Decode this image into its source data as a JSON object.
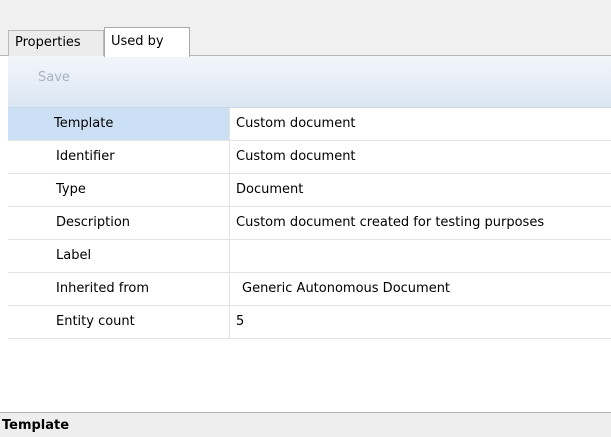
{
  "tabs": {
    "properties": "Properties",
    "used_by": "Used by"
  },
  "toolbar": {
    "save_label": "Save"
  },
  "grid": {
    "rows": [
      {
        "name": "Template",
        "value": "Custom document"
      },
      {
        "name": "Identifier",
        "value": "Custom document"
      },
      {
        "name": "Type",
        "value": "Document"
      },
      {
        "name": "Description",
        "value": "Custom document created for testing purposes"
      },
      {
        "name": "Label",
        "value": ""
      },
      {
        "name": "Inherited from",
        "value": "Generic Autonomous Document"
      },
      {
        "name": "Entity count",
        "value": "5"
      }
    ]
  },
  "footer": {
    "title": "Template"
  },
  "colors": {
    "selection": "#cce0f5",
    "toolbar_top": "#f2f6fb",
    "toolbar_bottom": "#dbe6f3"
  }
}
